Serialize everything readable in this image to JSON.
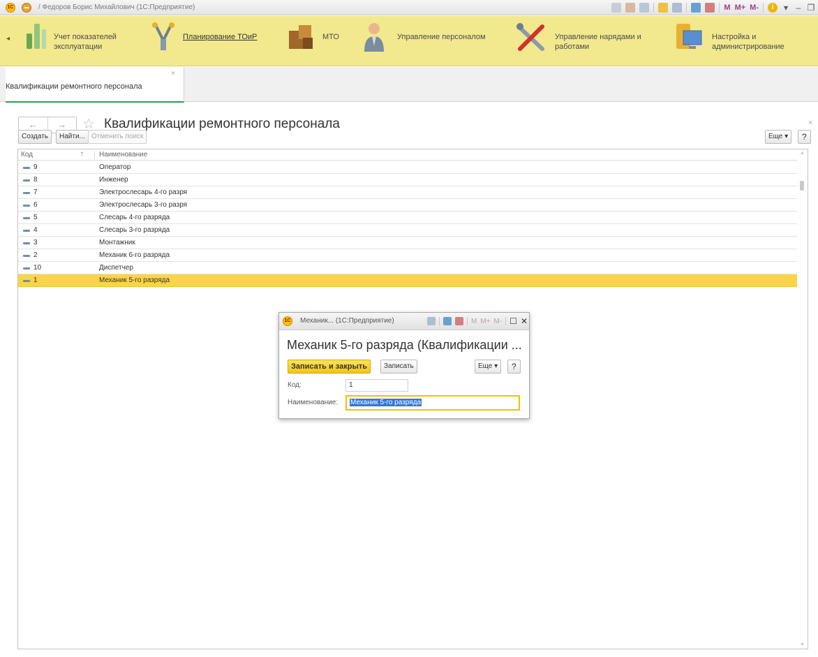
{
  "window": {
    "title": "/ Федоров Борис Михайлович  (1С:Предприятие)",
    "logo_text": "1С",
    "toolbar_m": [
      "M",
      "M+",
      "M-"
    ]
  },
  "sections": [
    {
      "label_line1": "Учет показателей",
      "label_line2": "эксплуатации",
      "icon": "chart-bars-icon"
    },
    {
      "label_line1": "Планирование ТОиР",
      "label_line2": "",
      "icon": "tools-icon"
    },
    {
      "label_line1": "МТО",
      "label_line2": "",
      "icon": "boxes-icon"
    },
    {
      "label_line1": "Управление персоналом",
      "label_line2": "",
      "icon": "person-icon"
    },
    {
      "label_line1": "Управление нарядами и",
      "label_line2": "работами",
      "icon": "wrench-screwdriver-icon"
    },
    {
      "label_line1": "Настройка и",
      "label_line2": "администрирование",
      "icon": "settings-computer-icon"
    }
  ],
  "tab": {
    "label": "Квалификации ремонтного персонала",
    "close": "×"
  },
  "form": {
    "title": "Квалификации ремонтного персонала",
    "close": "×",
    "nav_back": "←",
    "nav_forward": "→",
    "star": "☆",
    "buttons": {
      "create": "Создать",
      "find": "Найти...",
      "cancel_search": "Отменить поиск",
      "more": "Еще ▾",
      "help": "?"
    }
  },
  "table": {
    "columns": {
      "code": "Код",
      "sort": "↑",
      "name": "Наименование"
    },
    "rows": [
      {
        "code": "9",
        "name": "Оператор"
      },
      {
        "code": "8",
        "name": "Инженер"
      },
      {
        "code": "7",
        "name": "Электрослесарь 4-го разря"
      },
      {
        "code": "6",
        "name": "Электрослесарь 3-го разря"
      },
      {
        "code": "5",
        "name": "Слесарь 4-го разряда"
      },
      {
        "code": "4",
        "name": "Слесарь 3-го разряда"
      },
      {
        "code": "3",
        "name": "Монтажник"
      },
      {
        "code": "2",
        "name": "Механик 6-го разряда"
      },
      {
        "code": "10",
        "name": "Диспетчер"
      },
      {
        "code": "1",
        "name": "Механик 5-го разряда"
      }
    ],
    "selected_index": 9
  },
  "dialog": {
    "title": "Механик...  (1С:Предприятие)",
    "heading": "Механик 5-го разряда (Квалификации ...",
    "buttons": {
      "save_close": "Записать и закрыть",
      "save": "Записать",
      "more": "Еще ▾",
      "help": "?"
    },
    "fields": {
      "code_label": "Код:",
      "code_value": "1",
      "name_label": "Наименование:",
      "name_value": "Механик 5-го разряда"
    },
    "toolbar_m": [
      "M",
      "M+",
      "M-"
    ]
  },
  "colors": {
    "section_panel": "#f2e88d",
    "selected_row": "#fad44a",
    "primary_button": "#f2c417",
    "active_tab_underline": "#2e9c4a"
  }
}
